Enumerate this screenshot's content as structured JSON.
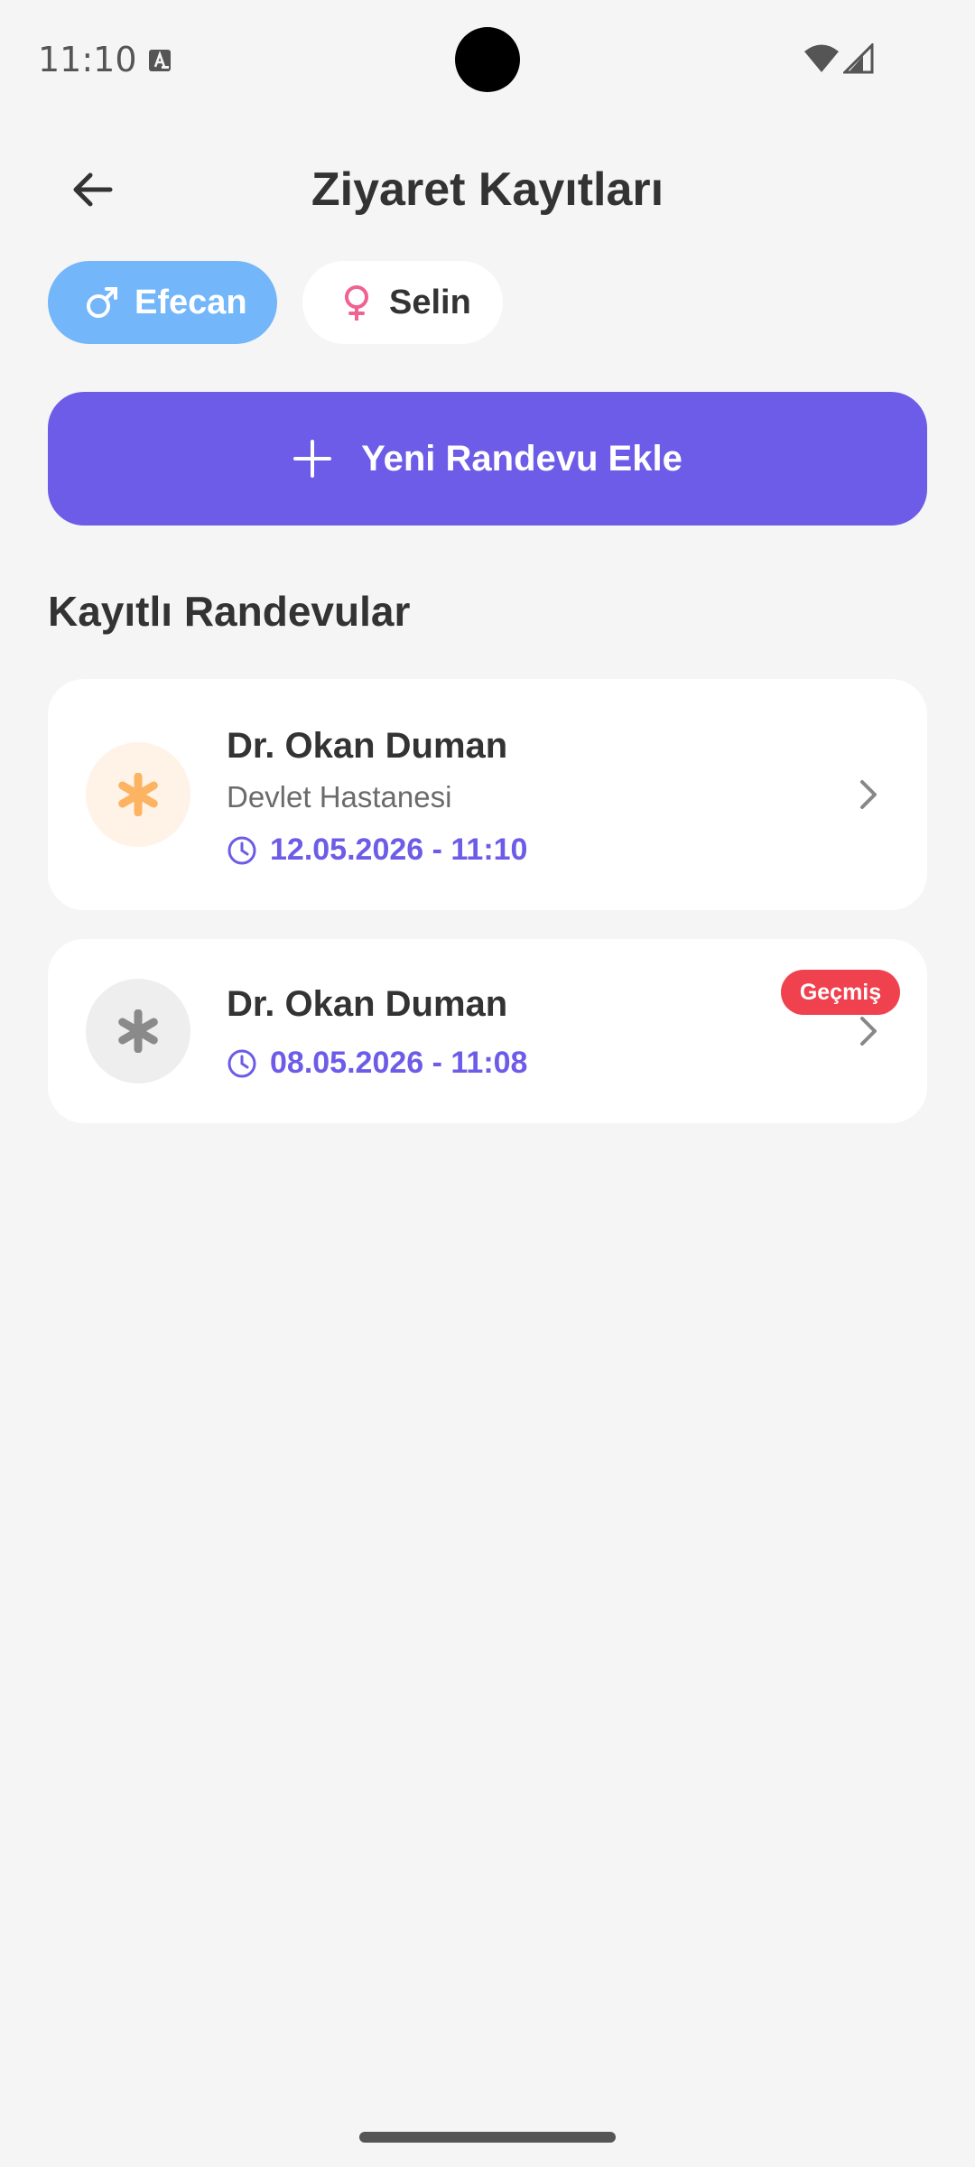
{
  "status_bar": {
    "time": "11:10",
    "icons": [
      "keyboard-a-icon",
      "wifi-icon",
      "signal-icon"
    ]
  },
  "header": {
    "title": "Ziyaret Kayıtları",
    "back_icon": "arrow-left-icon"
  },
  "profiles": [
    {
      "name": "Efecan",
      "icon": "male-symbol-icon",
      "selected": true,
      "color": "#73B6FA"
    },
    {
      "name": "Selin",
      "icon": "female-symbol-icon",
      "selected": false,
      "color": "#F06292"
    }
  ],
  "add_button": {
    "label": "Yeni Randevu Ekle",
    "icon": "plus-icon",
    "color": "#6C5CE7"
  },
  "section_title": "Kayıtlı Randevular",
  "appointments": [
    {
      "doctor": "Dr. Okan Duman",
      "hospital": "Devlet Hastanesi",
      "datetime": "12.05.2026 - 11:10",
      "icon": "asterisk-icon",
      "icon_color": "#FDB462",
      "past": false
    },
    {
      "doctor": "Dr. Okan Duman",
      "datetime": "08.05.2026 - 11:08",
      "icon": "asterisk-icon",
      "icon_color": "#8A8A8A",
      "past": true,
      "badge": "Geçmiş",
      "badge_color": "#F0414F"
    }
  ]
}
